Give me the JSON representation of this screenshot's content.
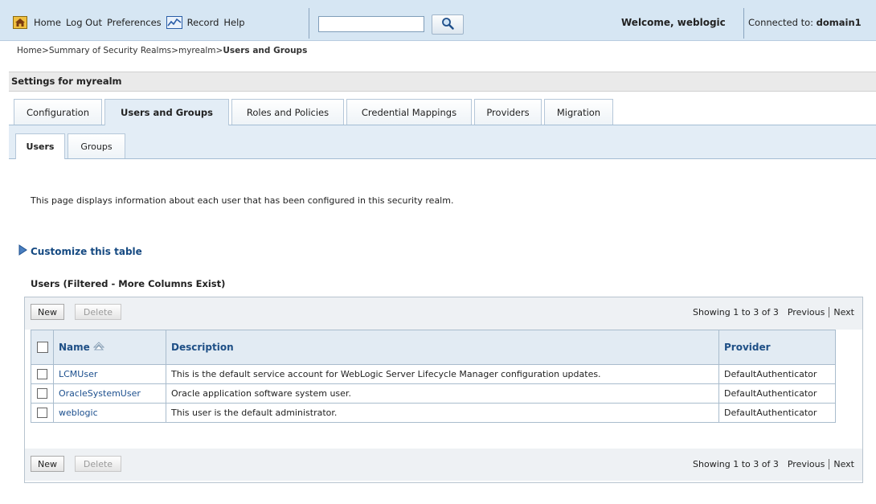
{
  "header": {
    "nav": [
      "Home",
      "Log Out",
      "Preferences",
      "Record",
      "Help"
    ],
    "search": {
      "value": "",
      "placeholder": ""
    },
    "welcome": "Welcome, weblogic",
    "connected_label": "Connected to:",
    "connected_value": "domain1"
  },
  "breadcrumb": {
    "items": [
      "Home",
      "Summary of Security Realms",
      "myrealm"
    ],
    "current": "Users and Groups",
    "separator": ">"
  },
  "settings_title": "Settings for myrealm",
  "tabs": [
    "Configuration",
    "Users and Groups",
    "Roles and Policies",
    "Credential Mappings",
    "Providers",
    "Migration"
  ],
  "active_tab": "Users and Groups",
  "subtabs": [
    "Users",
    "Groups"
  ],
  "active_subtab": "Users",
  "description": "This page displays information about each user that has been configured in this security realm.",
  "customize_label": "Customize this table",
  "table": {
    "title": "Users (Filtered - More Columns Exist)",
    "new_label": "New",
    "delete_label": "Delete",
    "showing": "Showing 1 to 3 of 3",
    "previous": "Previous",
    "next": "Next",
    "columns": [
      "Name",
      "Description",
      "Provider"
    ],
    "rows": [
      {
        "name": "LCMUser",
        "description": "This is the default service account for WebLogic Server Lifecycle Manager configuration updates.",
        "provider": "DefaultAuthenticator"
      },
      {
        "name": "OracleSystemUser",
        "description": "Oracle application software system user.",
        "provider": "DefaultAuthenticator"
      },
      {
        "name": "weblogic",
        "description": "This user is the default administrator.",
        "provider": "DefaultAuthenticator"
      }
    ]
  },
  "colors": {
    "topbar": "#d6e6f3",
    "link": "#1c4f8e",
    "header_text": "#1e4f86",
    "tab_active_bg": "#e3edf6"
  }
}
